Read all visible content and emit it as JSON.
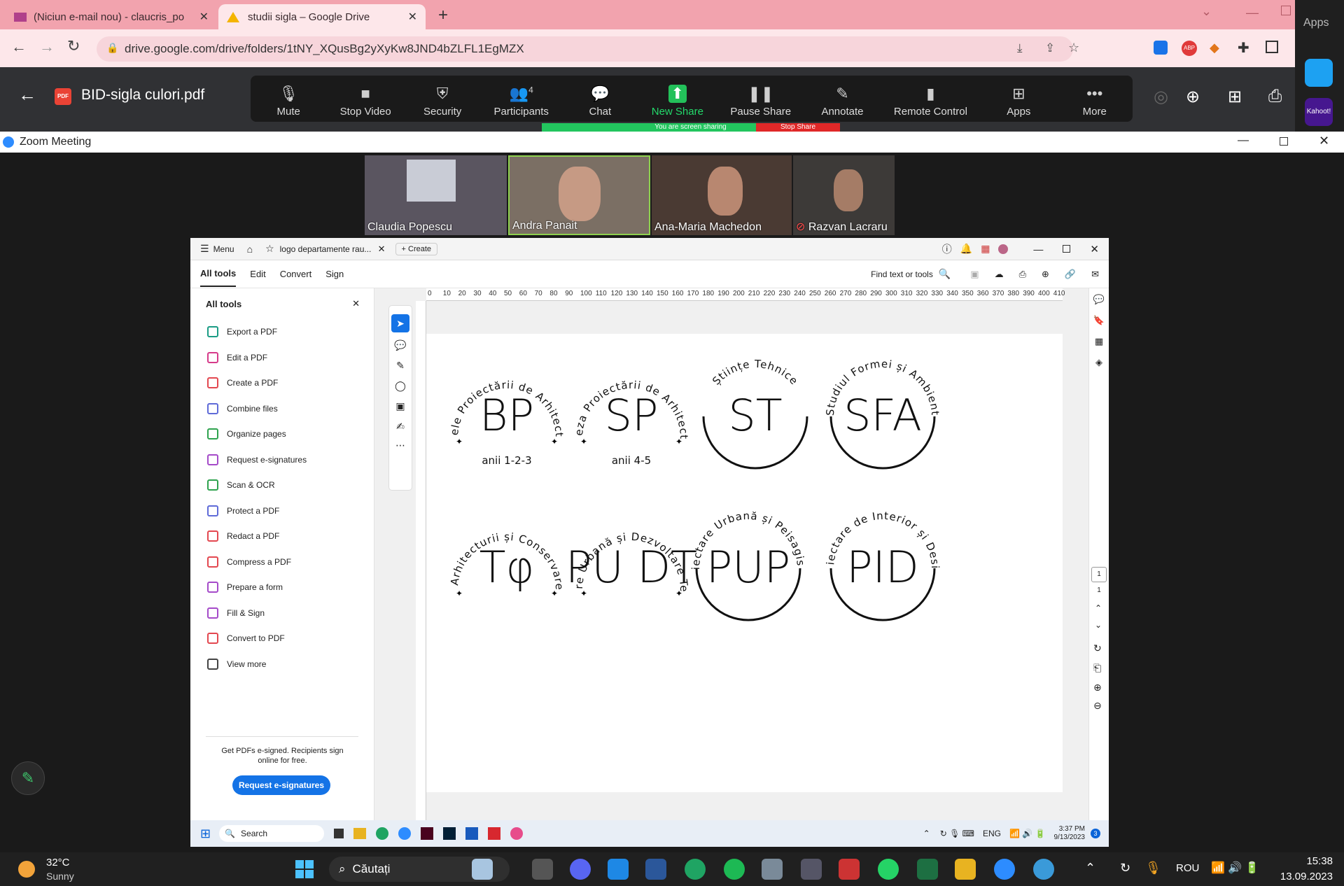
{
  "browser": {
    "tabs": [
      {
        "title": "(Niciun e-mail nou) - claucris_po",
        "active": false
      },
      {
        "title": "studii sigla – Google Drive",
        "active": true
      }
    ],
    "new_tab": "+",
    "url": "drive.google.com/drive/folders/1tNY_XQusBg2yXyKw8JND4bZLFL1EgMZX",
    "apps_label": "Apps",
    "kahoot_label": "Kahoot!"
  },
  "drive": {
    "file_title": "BID-sigla culori.pdf",
    "pdf_badge": "PDF"
  },
  "zoom_toolbar": {
    "mute": "Mute",
    "stop_video": "Stop Video",
    "security": "Security",
    "participants": "Participants",
    "participants_count": "4",
    "chat": "Chat",
    "new_share": "New Share",
    "pause_share": "Pause Share",
    "annotate": "Annotate",
    "remote_control": "Remote Control",
    "apps": "Apps",
    "more": "More",
    "sharing_banner": "You are screen sharing",
    "stop_share": "Stop Share"
  },
  "zoom_window": {
    "title": "Zoom Meeting",
    "participants": [
      {
        "name": "Claudia Popescu",
        "bg": "#5a5560"
      },
      {
        "name": "Andra Panait",
        "bg": "#7b6f64",
        "active_speaker": true
      },
      {
        "name": "Ana-Maria Machedon",
        "bg": "#4a3a33"
      },
      {
        "name": "Razvan Lacraru",
        "bg": "#3d3a38",
        "muted": true
      }
    ]
  },
  "acrobat": {
    "menu": "Menu",
    "doc_tab": "logo departamente rau...",
    "create": "Create",
    "nav": [
      "All tools",
      "Edit",
      "Convert",
      "Sign"
    ],
    "find": "Find text or tools",
    "panel_title": "All tools",
    "tools": [
      {
        "label": "Export a PDF",
        "color": "#1b9c85"
      },
      {
        "label": "Edit a PDF",
        "color": "#d63b8a"
      },
      {
        "label": "Create a PDF",
        "color": "#e34850"
      },
      {
        "label": "Combine files",
        "color": "#5f6bd8"
      },
      {
        "label": "Organize pages",
        "color": "#2fa34f"
      },
      {
        "label": "Request e-signatures",
        "color": "#a54bc9"
      },
      {
        "label": "Scan & OCR",
        "color": "#2fa34f"
      },
      {
        "label": "Protect a PDF",
        "color": "#5f6bd8"
      },
      {
        "label": "Redact a PDF",
        "color": "#e34850"
      },
      {
        "label": "Compress a PDF",
        "color": "#e34850"
      },
      {
        "label": "Prepare a form",
        "color": "#a54bc9"
      },
      {
        "label": "Fill & Sign",
        "color": "#a54bc9"
      },
      {
        "label": "Convert to PDF",
        "color": "#e34850"
      },
      {
        "label": "View more",
        "color": "#444"
      }
    ],
    "promo_text": "Get PDFs e-signed. Recipients sign online for free.",
    "promo_button": "Request e-signatures",
    "ruler_ticks": [
      "0",
      "10",
      "20",
      "30",
      "40",
      "50",
      "60",
      "70",
      "80",
      "90",
      "100",
      "110",
      "120",
      "130",
      "140",
      "150",
      "160",
      "170",
      "180",
      "190",
      "200",
      "210",
      "220",
      "230",
      "240",
      "250",
      "260",
      "270",
      "280",
      "290",
      "300",
      "310",
      "320",
      "330",
      "340",
      "350",
      "360",
      "370",
      "380",
      "390",
      "400",
      "410"
    ],
    "page_num": "1",
    "page_total": "1",
    "logos": [
      {
        "ring_text": "Bazele Proiectării de Arhitectură",
        "mono": "BP",
        "sub": "anii 1-2-3"
      },
      {
        "ring_text": "Sinteza Proiectării de Arhitectură",
        "mono": "SP",
        "sub": "anii 4-5"
      },
      {
        "ring_text": "Științe Tehnice",
        "mono": "ST",
        "sub": ""
      },
      {
        "ring_text": "Studiul Formei și Ambient",
        "mono": "SFA",
        "sub": ""
      },
      {
        "ring_text": "Istoria & Teoria Arhitecturii și Conservarea Patrimoniului",
        "mono": "Tφ",
        "sub": ""
      },
      {
        "ring_text": "Planificare Urbană și Dezvoltare Teritorială",
        "mono": "PU DT",
        "sub": ""
      },
      {
        "ring_text": "Proiectare Urbană și Peisagistică",
        "mono": "PUP",
        "sub": ""
      },
      {
        "ring_text": "Proiectare de Interior și Design",
        "mono": "PID",
        "sub": ""
      }
    ],
    "inner_taskbar": {
      "search": "Search",
      "lang": "ENG",
      "time": "3:37 PM",
      "date": "9/13/2023",
      "badge": "3"
    }
  },
  "taskbar": {
    "weather_temp": "32°C",
    "weather_desc": "Sunny",
    "search": "Căutați",
    "lang": "ROU",
    "time": "15:38",
    "date": "13.09.2023"
  }
}
